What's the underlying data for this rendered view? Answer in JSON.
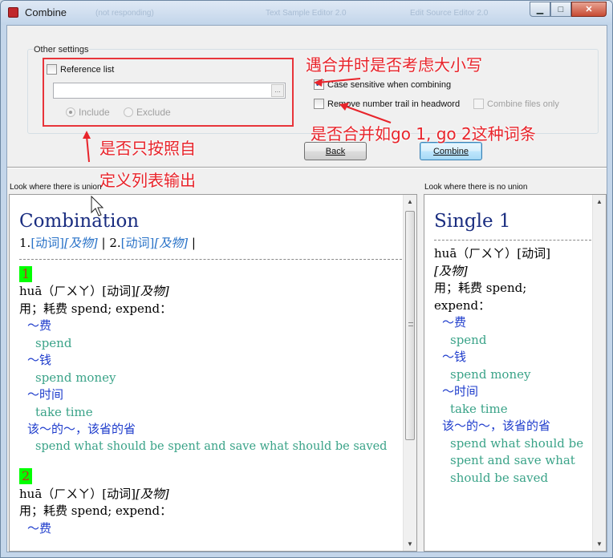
{
  "window": {
    "title": "Combine",
    "background_text": [
      "(not responding)",
      "Text Sample Editor 2.0",
      "Edit Source Editor 2.0"
    ]
  },
  "settings": {
    "group_label": "Other settings",
    "reference_list_label": "Reference list",
    "reference_list_checked": false,
    "path_value": "",
    "path_button": "...",
    "include_label": "Include",
    "exclude_label": "Exclude",
    "include_selected": true,
    "case_sensitive_label": "Case sensitive when combining",
    "case_sensitive_checked": true,
    "remove_trail_label": "Remove number trail in headword",
    "remove_trail_checked": false,
    "combine_files_label": "Combine files only",
    "combine_files_checked": false
  },
  "buttons": {
    "back": "Back",
    "combine": "Combine"
  },
  "annotations": {
    "case_note": "遇合并时是否考虑大小写",
    "trail_note": "是否合并如go 1, go 2这种词条",
    "list_note_line1": "是否只按照自",
    "list_note_line2": "定义列表输出"
  },
  "left_panel": {
    "label": "Look where there is union",
    "heading": "Combination",
    "links": {
      "n1": "1.",
      "w1": "[动词]",
      "p1": "[及物]",
      "sep": " | ",
      "n2": "2.",
      "w2": "[动词]",
      "p2": "[及物]",
      "end": " |"
    },
    "entries": [
      {
        "number": "1",
        "pron": "huā（ㄏㄨㄚ）[动词]",
        "pos": "[及物]",
        "def": "用；耗费  spend; expend：",
        "ex1_cn": "～费",
        "ex1_en": "spend",
        "ex2_cn": "～钱",
        "ex2_en": "spend money",
        "ex3_cn": "～时间",
        "ex3_en": "take time",
        "ex4_cn": "该～的～，该省的省",
        "ex4_en": "spend what should be spent and save what should be saved"
      },
      {
        "number": "2",
        "pron": "huā（ㄏㄨㄚ）[动词]",
        "pos": "[及物]",
        "def": "用；耗费  spend; expend：",
        "ex1_cn": "～费"
      }
    ]
  },
  "right_panel": {
    "label": "Look where there is no union",
    "heading": "Single 1",
    "pron": "huā（ㄏㄨㄚ）[动词]",
    "pos": "[及物]",
    "def1": "用；耗费  spend;",
    "def2": "expend：",
    "ex1_cn": "～费",
    "ex1_en": "spend",
    "ex2_cn": "～钱",
    "ex2_en": "spend money",
    "ex3_cn": "～时间",
    "ex3_en": "take time",
    "ex4_cn": "该～的～，该省的省",
    "ex4_en_1": "spend what should be",
    "ex4_en_2": "spent and save what",
    "ex4_en_3": "should be saved"
  },
  "colors": {
    "annotation": "#e8242b",
    "heading": "#1a2d80",
    "chinese_example": "#1e3ccc",
    "english_example": "#3aa388",
    "number_badge": "#00ff00"
  }
}
